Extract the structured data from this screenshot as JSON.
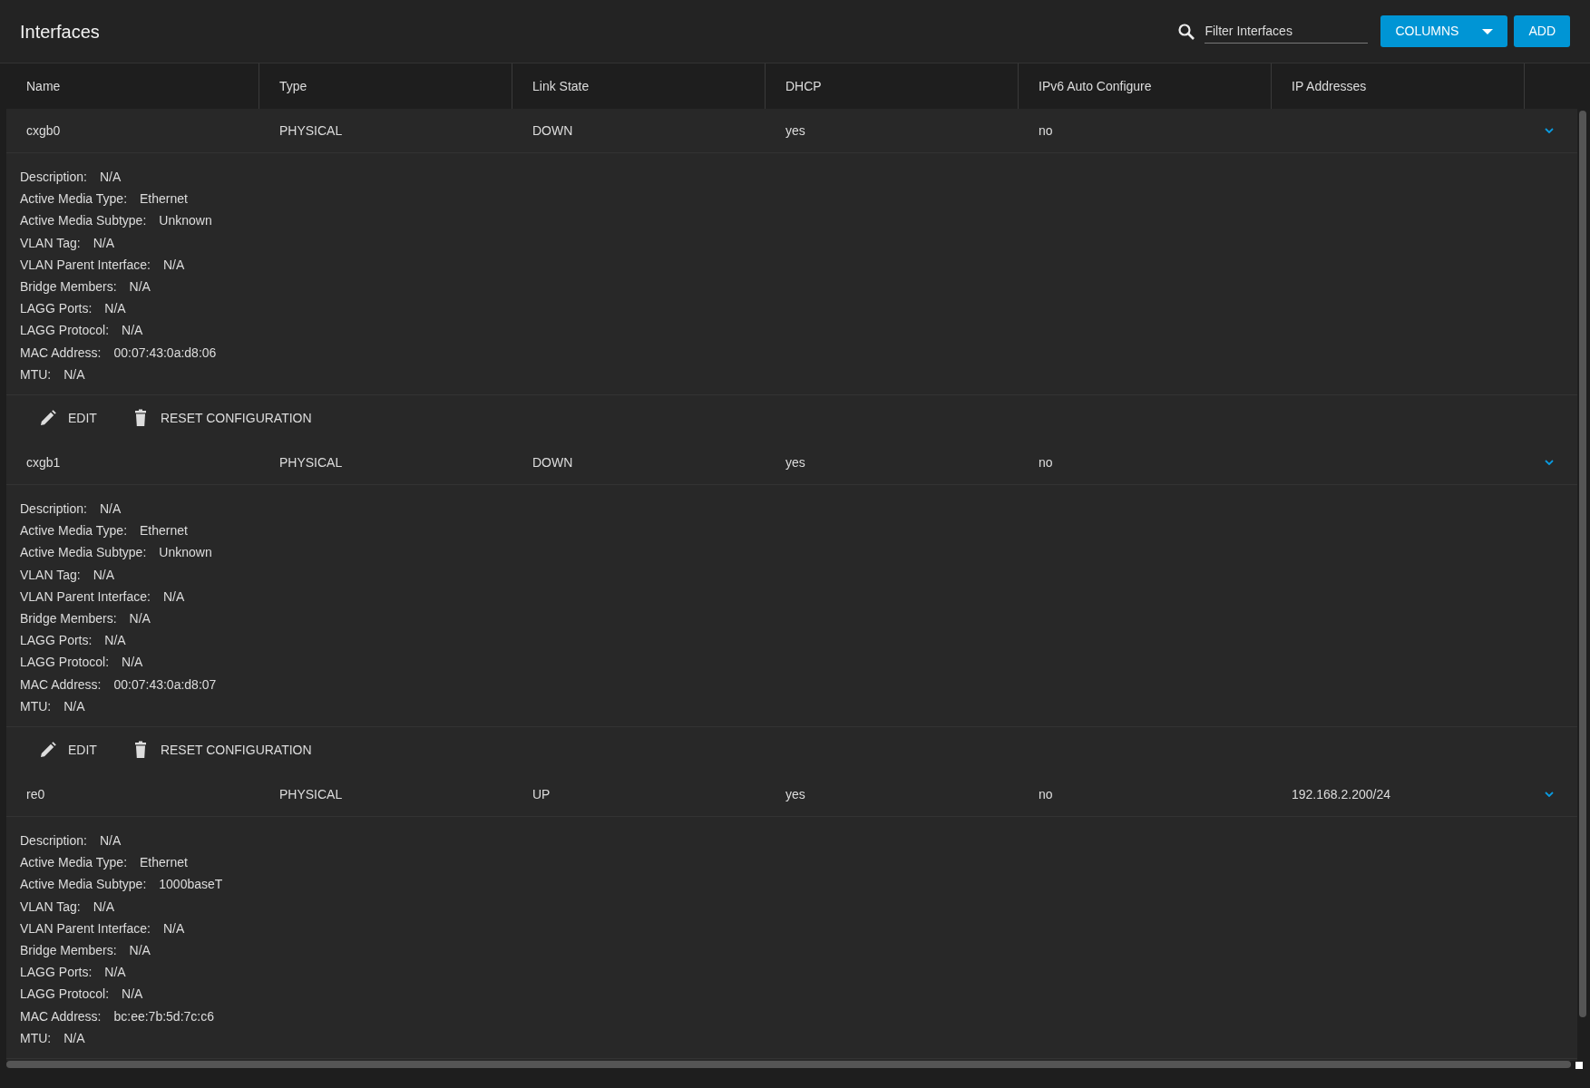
{
  "header": {
    "title": "Interfaces",
    "filter": {
      "placeholder": "Filter Interfaces"
    },
    "buttons": [
      {
        "kind": "dropdown",
        "label": "COLUMNS"
      },
      {
        "kind": "plain",
        "label": "ADD"
      }
    ]
  },
  "table": {
    "columns": [
      "Name",
      "Type",
      "Link State",
      "DHCP",
      "IPv6 Auto Configure",
      "IP Addresses"
    ],
    "rows": [
      {
        "cells": [
          "cxgb0",
          "PHYSICAL",
          "DOWN",
          "yes",
          "no",
          ""
        ],
        "expanded": true,
        "details": [
          {
            "label": "Description:",
            "value": "N/A"
          },
          {
            "label": "Active Media Type:",
            "value": "Ethernet"
          },
          {
            "label": "Active Media Subtype:",
            "value": "Unknown"
          },
          {
            "label": "VLAN Tag:",
            "value": "N/A"
          },
          {
            "label": "VLAN Parent Interface:",
            "value": "N/A"
          },
          {
            "label": "Bridge Members:",
            "value": "N/A"
          },
          {
            "label": "LAGG Ports:",
            "value": "N/A"
          },
          {
            "label": "LAGG Protocol:",
            "value": "N/A"
          },
          {
            "label": "MAC Address:",
            "value": "00:07:43:0a:d8:06"
          },
          {
            "label": "MTU:",
            "value": "N/A"
          }
        ],
        "actions": [
          {
            "kind": "edit",
            "label": "EDIT"
          },
          {
            "kind": "delete",
            "label": "RESET CONFIGURATION"
          }
        ]
      },
      {
        "cells": [
          "cxgb1",
          "PHYSICAL",
          "DOWN",
          "yes",
          "no",
          ""
        ],
        "expanded": true,
        "details": [
          {
            "label": "Description:",
            "value": "N/A"
          },
          {
            "label": "Active Media Type:",
            "value": "Ethernet"
          },
          {
            "label": "Active Media Subtype:",
            "value": "Unknown"
          },
          {
            "label": "VLAN Tag:",
            "value": "N/A"
          },
          {
            "label": "VLAN Parent Interface:",
            "value": "N/A"
          },
          {
            "label": "Bridge Members:",
            "value": "N/A"
          },
          {
            "label": "LAGG Ports:",
            "value": "N/A"
          },
          {
            "label": "LAGG Protocol:",
            "value": "N/A"
          },
          {
            "label": "MAC Address:",
            "value": "00:07:43:0a:d8:07"
          },
          {
            "label": "MTU:",
            "value": "N/A"
          }
        ],
        "actions": [
          {
            "kind": "edit",
            "label": "EDIT"
          },
          {
            "kind": "delete",
            "label": "RESET CONFIGURATION"
          }
        ]
      },
      {
        "cells": [
          "re0",
          "PHYSICAL",
          "UP",
          "yes",
          "no",
          "192.168.2.200/24"
        ],
        "expanded": true,
        "details": [
          {
            "label": "Description:",
            "value": "N/A"
          },
          {
            "label": "Active Media Type:",
            "value": "Ethernet"
          },
          {
            "label": "Active Media Subtype:",
            "value": "1000baseT"
          },
          {
            "label": "VLAN Tag:",
            "value": "N/A"
          },
          {
            "label": "VLAN Parent Interface:",
            "value": "N/A"
          },
          {
            "label": "Bridge Members:",
            "value": "N/A"
          },
          {
            "label": "LAGG Ports:",
            "value": "N/A"
          },
          {
            "label": "LAGG Protocol:",
            "value": "N/A"
          },
          {
            "label": "MAC Address:",
            "value": "bc:ee:7b:5d:7c:c6"
          },
          {
            "label": "MTU:",
            "value": "N/A"
          }
        ],
        "actions": []
      }
    ]
  }
}
